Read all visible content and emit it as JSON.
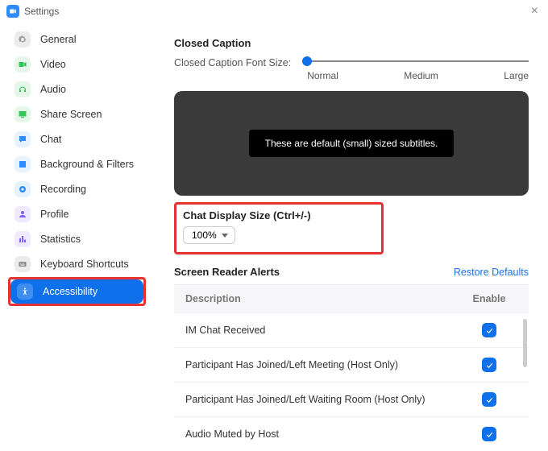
{
  "window": {
    "title": "Settings"
  },
  "sidebar": {
    "items": [
      {
        "label": "General"
      },
      {
        "label": "Video"
      },
      {
        "label": "Audio"
      },
      {
        "label": "Share Screen"
      },
      {
        "label": "Chat"
      },
      {
        "label": "Background & Filters"
      },
      {
        "label": "Recording"
      },
      {
        "label": "Profile"
      },
      {
        "label": "Statistics"
      },
      {
        "label": "Keyboard Shortcuts"
      },
      {
        "label": "Accessibility"
      }
    ]
  },
  "closed_caption": {
    "title": "Closed Caption",
    "font_size_label": "Closed Caption Font Size:",
    "ticks": {
      "normal": "Normal",
      "medium": "Medium",
      "large": "Large"
    },
    "preview_text": "These are default (small) sized subtitles."
  },
  "chat_display": {
    "title": "Chat Display Size (Ctrl+/-)",
    "value": "100%"
  },
  "screen_reader": {
    "title": "Screen Reader Alerts",
    "restore": "Restore Defaults",
    "columns": {
      "description": "Description",
      "enable": "Enable"
    },
    "rows": [
      {
        "desc": "IM Chat Received",
        "enabled": true
      },
      {
        "desc": "Participant Has Joined/Left Meeting (Host Only)",
        "enabled": true
      },
      {
        "desc": "Participant Has Joined/Left Waiting Room (Host Only)",
        "enabled": true
      },
      {
        "desc": "Audio Muted by Host",
        "enabled": true
      }
    ]
  }
}
